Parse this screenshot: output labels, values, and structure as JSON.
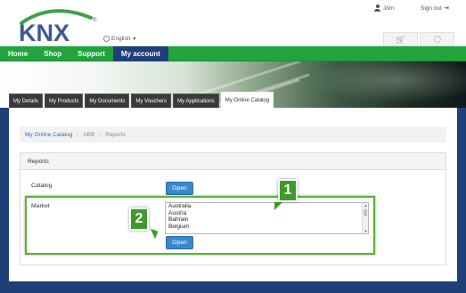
{
  "header": {
    "logo_text": "KNX",
    "language": "English",
    "user_name": "Jörn",
    "sign_out": "Sign out"
  },
  "nav": {
    "items": [
      {
        "label": "Home"
      },
      {
        "label": "Shop"
      },
      {
        "label": "Support"
      },
      {
        "label": "My account"
      }
    ]
  },
  "tabs": [
    {
      "label": "My Details"
    },
    {
      "label": "My Products"
    },
    {
      "label": "My Documents"
    },
    {
      "label": "My Vouchers"
    },
    {
      "label": "My Applications"
    },
    {
      "label": "My Online Catalog"
    }
  ],
  "breadcrumb": {
    "link": "My Online Catalog",
    "sep": "/",
    "item2": "ABB",
    "item3": "Reports"
  },
  "panel": {
    "title": "Reports",
    "catalog_label": "Catalog",
    "market_label": "Market",
    "open_label": "Open",
    "market_options": [
      "Australia",
      "Austria",
      "Bahrain",
      "Belgium"
    ]
  },
  "callouts": {
    "one": "1",
    "two": "2"
  },
  "colors": {
    "brand_green": "#22a43d",
    "nav_active": "#1d3f7a",
    "button_blue": "#3a87cd",
    "highlight_green": "#57b336"
  },
  "icons": [
    "user-icon",
    "sign-out-icon",
    "globe-icon",
    "cart-icon",
    "caret-down-icon"
  ]
}
